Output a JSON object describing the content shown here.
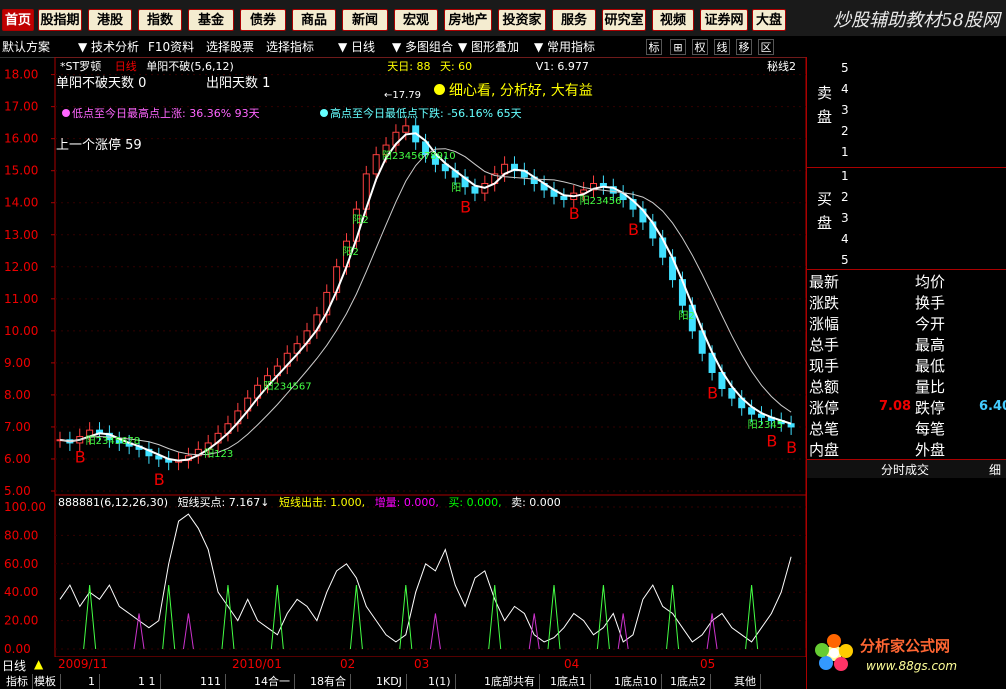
{
  "nav": {
    "buttons": [
      {
        "label": "首页",
        "red": true
      },
      {
        "label": "股指期",
        "red": false
      },
      {
        "label": "港股",
        "red": false
      },
      {
        "label": "指数",
        "red": false
      },
      {
        "label": "基金",
        "red": false
      },
      {
        "label": "债券",
        "red": false
      },
      {
        "label": "商品",
        "red": false
      },
      {
        "label": "新闻",
        "red": false
      },
      {
        "label": "宏观",
        "red": false
      },
      {
        "label": "房地产",
        "red": false
      },
      {
        "label": "投资家",
        "red": false
      },
      {
        "label": "服务",
        "red": false
      },
      {
        "label": "研究室",
        "red": false
      },
      {
        "label": "视频",
        "red": false
      },
      {
        "label": "证券网",
        "red": false
      },
      {
        "label": "大盘",
        "red": false
      }
    ],
    "brand": "炒股辅助教材58股网",
    "brand_url": "www.58Gu.com"
  },
  "toolbar": {
    "items": [
      "默认方案",
      "技术分析",
      "F10资料",
      "选择股票",
      "选择指标",
      "日线",
      "多图组合",
      "图形叠加",
      "常用指标"
    ],
    "toggles": [
      "标",
      "⊞",
      "权",
      "线",
      "移",
      "区"
    ]
  },
  "chart_header": {
    "stock": "*ST罗顿",
    "period": "日线",
    "indicator": "单阳不破(5,6,12)",
    "line1": "单阳不破天数 0",
    "line2": "出阳天数 1",
    "day_info": "天日: 88",
    "day2": "天: 60",
    "v1": "V1: 6.977",
    "right_tag": "秘线2",
    "motto": "细心看, 分析好, 大有益",
    "low_note": "低点至今日最高点上涨: 36.36%  93天",
    "high_note": "高点至今日最低点下跌: -56.16%  65天",
    "prev_limit": "上一个涨停 59",
    "peak": "17.79"
  },
  "chart_data": {
    "type": "candlestick",
    "yticks": [
      "18.00",
      "17.00",
      "16.00",
      "15.00",
      "14.00",
      "13.00",
      "12.00",
      "11.00",
      "10.00",
      "9.00",
      "8.00",
      "7.00",
      "6.00",
      "5.00"
    ],
    "ylim": [
      5,
      18.3
    ],
    "sub_yticks": [
      "100.00",
      "80.00",
      "60.00",
      "40.00",
      "20.00",
      "0.00"
    ],
    "sub_header": {
      "name": "888881(6,12,26,30)",
      "buy": "短线买点: 7.167↓",
      "sell": "短线出击: 1.000,",
      "inc": "增量: 0.000,",
      "b": "买: 0.000,",
      "s": "卖: 0.000"
    },
    "dates": [
      "2009/11",
      "2010/01",
      "02",
      "03",
      "04",
      "05"
    ],
    "annotations": [
      "B",
      "B",
      "B",
      "B",
      "B",
      "B",
      "B",
      "B"
    ],
    "yang_labels": [
      "阳2345678",
      "阳2345678910",
      "阳23456",
      "阳234567",
      "阳123",
      "阳2",
      "阳",
      "阳2",
      "阳2",
      "阳2345"
    ]
  },
  "orderbook": {
    "sell_label": "卖\n盘",
    "buy_label": "买\n盘",
    "sell": [
      "5",
      "4",
      "3",
      "2",
      "1"
    ],
    "buy": [
      "1",
      "2",
      "3",
      "4",
      "5"
    ]
  },
  "quote": {
    "rows": [
      [
        "最新",
        "均价"
      ],
      [
        "涨跌",
        "换手"
      ],
      [
        "涨幅",
        "今开"
      ],
      [
        "总手",
        "最高"
      ],
      [
        "现手",
        "最低"
      ],
      [
        "总额",
        "量比"
      ],
      [
        "涨停",
        "跌停"
      ],
      [
        "总笔",
        "每笔"
      ],
      [
        "内盘",
        "外盘"
      ]
    ],
    "limit_up": "7.08",
    "limit_down": "6.40",
    "tick_tab": "分时成交",
    "tick_tab2": "细"
  },
  "bottom": {
    "period": "日线",
    "tabs": [
      "指标",
      "模板",
      "1",
      "1 1",
      "111",
      "14合一",
      "18有合",
      "1KDJ",
      "1(1)",
      "1底部共有",
      "1底点1",
      "1底点10",
      "1底点2",
      "其他"
    ]
  },
  "watermark": {
    "site": "分析家公式网",
    "url": "www.88gs.com"
  },
  "colors": {
    "accent": "#e00000",
    "up": "#ff4040",
    "down": "#40e0ff",
    "ma": "#ffffff"
  }
}
